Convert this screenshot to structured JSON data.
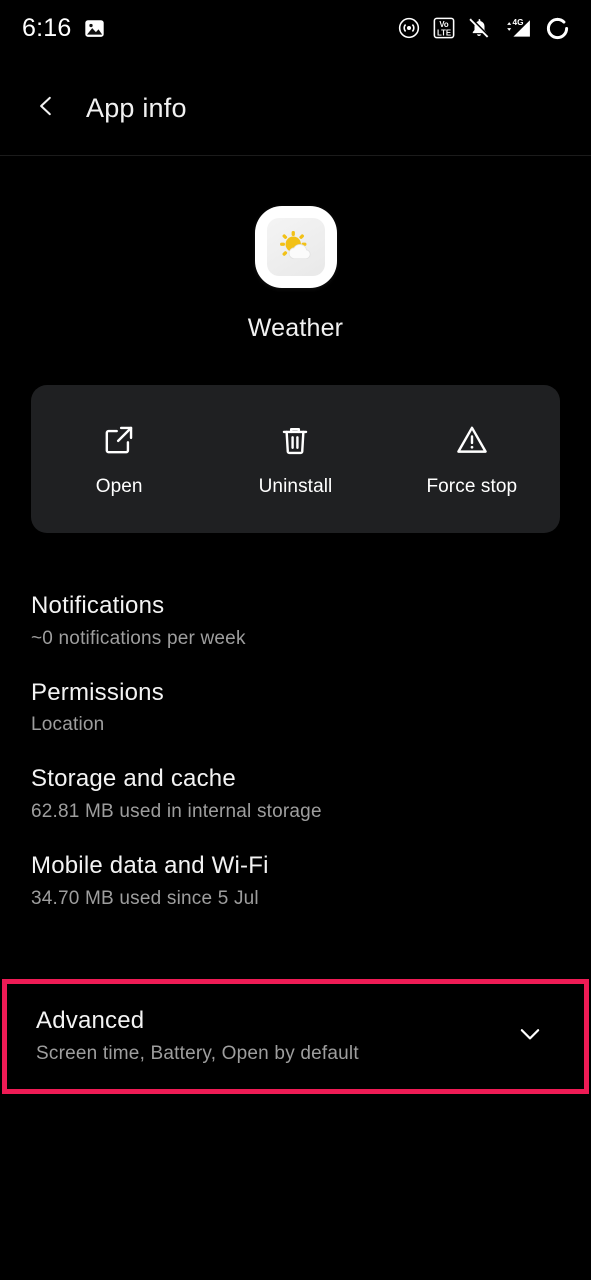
{
  "statusbar": {
    "time": "6:16",
    "left_icons": [
      {
        "name": "gallery-icon",
        "label": "Gallery notification"
      }
    ],
    "right_icons": [
      {
        "name": "hotspot-icon",
        "label": "Hotspot"
      },
      {
        "name": "volte-icon",
        "label": "VoLTE"
      },
      {
        "name": "ringer-muted-icon",
        "label": "Ringer silenced"
      },
      {
        "name": "mobile-signal-4g-icon",
        "label": "4G"
      },
      {
        "name": "battery-ring-icon",
        "label": "Battery"
      }
    ],
    "volte_top": "Vo",
    "volte_bottom": "LTE",
    "network_label": "4G"
  },
  "header": {
    "title": "App info",
    "back_icon": "chevron-left-icon"
  },
  "app": {
    "name": "Weather",
    "icon_name": "weather-app-icon"
  },
  "actions": [
    {
      "label": "Open",
      "icon": "open-in-new-icon"
    },
    {
      "label": "Uninstall",
      "icon": "trash-icon"
    },
    {
      "label": "Force stop",
      "icon": "warning-triangle-icon"
    }
  ],
  "settings": [
    {
      "title": "Notifications",
      "subtitle": "~0 notifications per week"
    },
    {
      "title": "Permissions",
      "subtitle": "Location"
    },
    {
      "title": "Storage and cache",
      "subtitle": "62.81 MB used in internal storage"
    },
    {
      "title": "Mobile data and Wi-Fi",
      "subtitle": "34.70 MB used since 5 Jul"
    }
  ],
  "advanced": {
    "title": "Advanced",
    "subtitle": "Screen time, Battery, Open by default",
    "expand_icon": "chevron-down-icon"
  },
  "colors": {
    "background": "#000000",
    "card": "#1f2022",
    "primary_text": "#f3f3f3",
    "secondary_text": "#9e9e9e",
    "highlight_border": "#EE1B55",
    "icon_sun": "#F2C117"
  }
}
